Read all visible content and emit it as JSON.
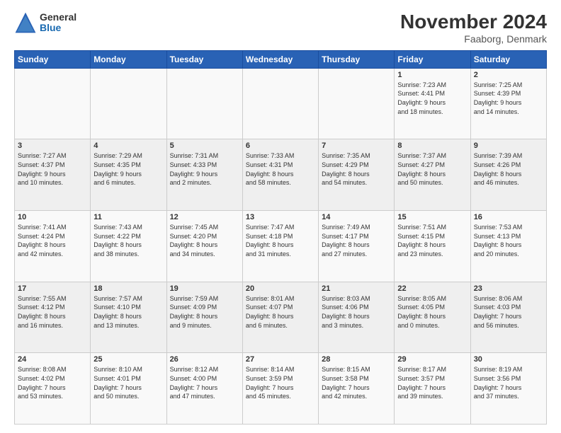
{
  "logo": {
    "general": "General",
    "blue": "Blue"
  },
  "title": "November 2024",
  "subtitle": "Faaborg, Denmark",
  "weekdays": [
    "Sunday",
    "Monday",
    "Tuesday",
    "Wednesday",
    "Thursday",
    "Friday",
    "Saturday"
  ],
  "weeks": [
    [
      {
        "day": "",
        "info": ""
      },
      {
        "day": "",
        "info": ""
      },
      {
        "day": "",
        "info": ""
      },
      {
        "day": "",
        "info": ""
      },
      {
        "day": "",
        "info": ""
      },
      {
        "day": "1",
        "info": "Sunrise: 7:23 AM\nSunset: 4:41 PM\nDaylight: 9 hours\nand 18 minutes."
      },
      {
        "day": "2",
        "info": "Sunrise: 7:25 AM\nSunset: 4:39 PM\nDaylight: 9 hours\nand 14 minutes."
      }
    ],
    [
      {
        "day": "3",
        "info": "Sunrise: 7:27 AM\nSunset: 4:37 PM\nDaylight: 9 hours\nand 10 minutes."
      },
      {
        "day": "4",
        "info": "Sunrise: 7:29 AM\nSunset: 4:35 PM\nDaylight: 9 hours\nand 6 minutes."
      },
      {
        "day": "5",
        "info": "Sunrise: 7:31 AM\nSunset: 4:33 PM\nDaylight: 9 hours\nand 2 minutes."
      },
      {
        "day": "6",
        "info": "Sunrise: 7:33 AM\nSunset: 4:31 PM\nDaylight: 8 hours\nand 58 minutes."
      },
      {
        "day": "7",
        "info": "Sunrise: 7:35 AM\nSunset: 4:29 PM\nDaylight: 8 hours\nand 54 minutes."
      },
      {
        "day": "8",
        "info": "Sunrise: 7:37 AM\nSunset: 4:27 PM\nDaylight: 8 hours\nand 50 minutes."
      },
      {
        "day": "9",
        "info": "Sunrise: 7:39 AM\nSunset: 4:26 PM\nDaylight: 8 hours\nand 46 minutes."
      }
    ],
    [
      {
        "day": "10",
        "info": "Sunrise: 7:41 AM\nSunset: 4:24 PM\nDaylight: 8 hours\nand 42 minutes."
      },
      {
        "day": "11",
        "info": "Sunrise: 7:43 AM\nSunset: 4:22 PM\nDaylight: 8 hours\nand 38 minutes."
      },
      {
        "day": "12",
        "info": "Sunrise: 7:45 AM\nSunset: 4:20 PM\nDaylight: 8 hours\nand 34 minutes."
      },
      {
        "day": "13",
        "info": "Sunrise: 7:47 AM\nSunset: 4:18 PM\nDaylight: 8 hours\nand 31 minutes."
      },
      {
        "day": "14",
        "info": "Sunrise: 7:49 AM\nSunset: 4:17 PM\nDaylight: 8 hours\nand 27 minutes."
      },
      {
        "day": "15",
        "info": "Sunrise: 7:51 AM\nSunset: 4:15 PM\nDaylight: 8 hours\nand 23 minutes."
      },
      {
        "day": "16",
        "info": "Sunrise: 7:53 AM\nSunset: 4:13 PM\nDaylight: 8 hours\nand 20 minutes."
      }
    ],
    [
      {
        "day": "17",
        "info": "Sunrise: 7:55 AM\nSunset: 4:12 PM\nDaylight: 8 hours\nand 16 minutes."
      },
      {
        "day": "18",
        "info": "Sunrise: 7:57 AM\nSunset: 4:10 PM\nDaylight: 8 hours\nand 13 minutes."
      },
      {
        "day": "19",
        "info": "Sunrise: 7:59 AM\nSunset: 4:09 PM\nDaylight: 8 hours\nand 9 minutes."
      },
      {
        "day": "20",
        "info": "Sunrise: 8:01 AM\nSunset: 4:07 PM\nDaylight: 8 hours\nand 6 minutes."
      },
      {
        "day": "21",
        "info": "Sunrise: 8:03 AM\nSunset: 4:06 PM\nDaylight: 8 hours\nand 3 minutes."
      },
      {
        "day": "22",
        "info": "Sunrise: 8:05 AM\nSunset: 4:05 PM\nDaylight: 8 hours\nand 0 minutes."
      },
      {
        "day": "23",
        "info": "Sunrise: 8:06 AM\nSunset: 4:03 PM\nDaylight: 7 hours\nand 56 minutes."
      }
    ],
    [
      {
        "day": "24",
        "info": "Sunrise: 8:08 AM\nSunset: 4:02 PM\nDaylight: 7 hours\nand 53 minutes."
      },
      {
        "day": "25",
        "info": "Sunrise: 8:10 AM\nSunset: 4:01 PM\nDaylight: 7 hours\nand 50 minutes."
      },
      {
        "day": "26",
        "info": "Sunrise: 8:12 AM\nSunset: 4:00 PM\nDaylight: 7 hours\nand 47 minutes."
      },
      {
        "day": "27",
        "info": "Sunrise: 8:14 AM\nSunset: 3:59 PM\nDaylight: 7 hours\nand 45 minutes."
      },
      {
        "day": "28",
        "info": "Sunrise: 8:15 AM\nSunset: 3:58 PM\nDaylight: 7 hours\nand 42 minutes."
      },
      {
        "day": "29",
        "info": "Sunrise: 8:17 AM\nSunset: 3:57 PM\nDaylight: 7 hours\nand 39 minutes."
      },
      {
        "day": "30",
        "info": "Sunrise: 8:19 AM\nSunset: 3:56 PM\nDaylight: 7 hours\nand 37 minutes."
      }
    ]
  ]
}
